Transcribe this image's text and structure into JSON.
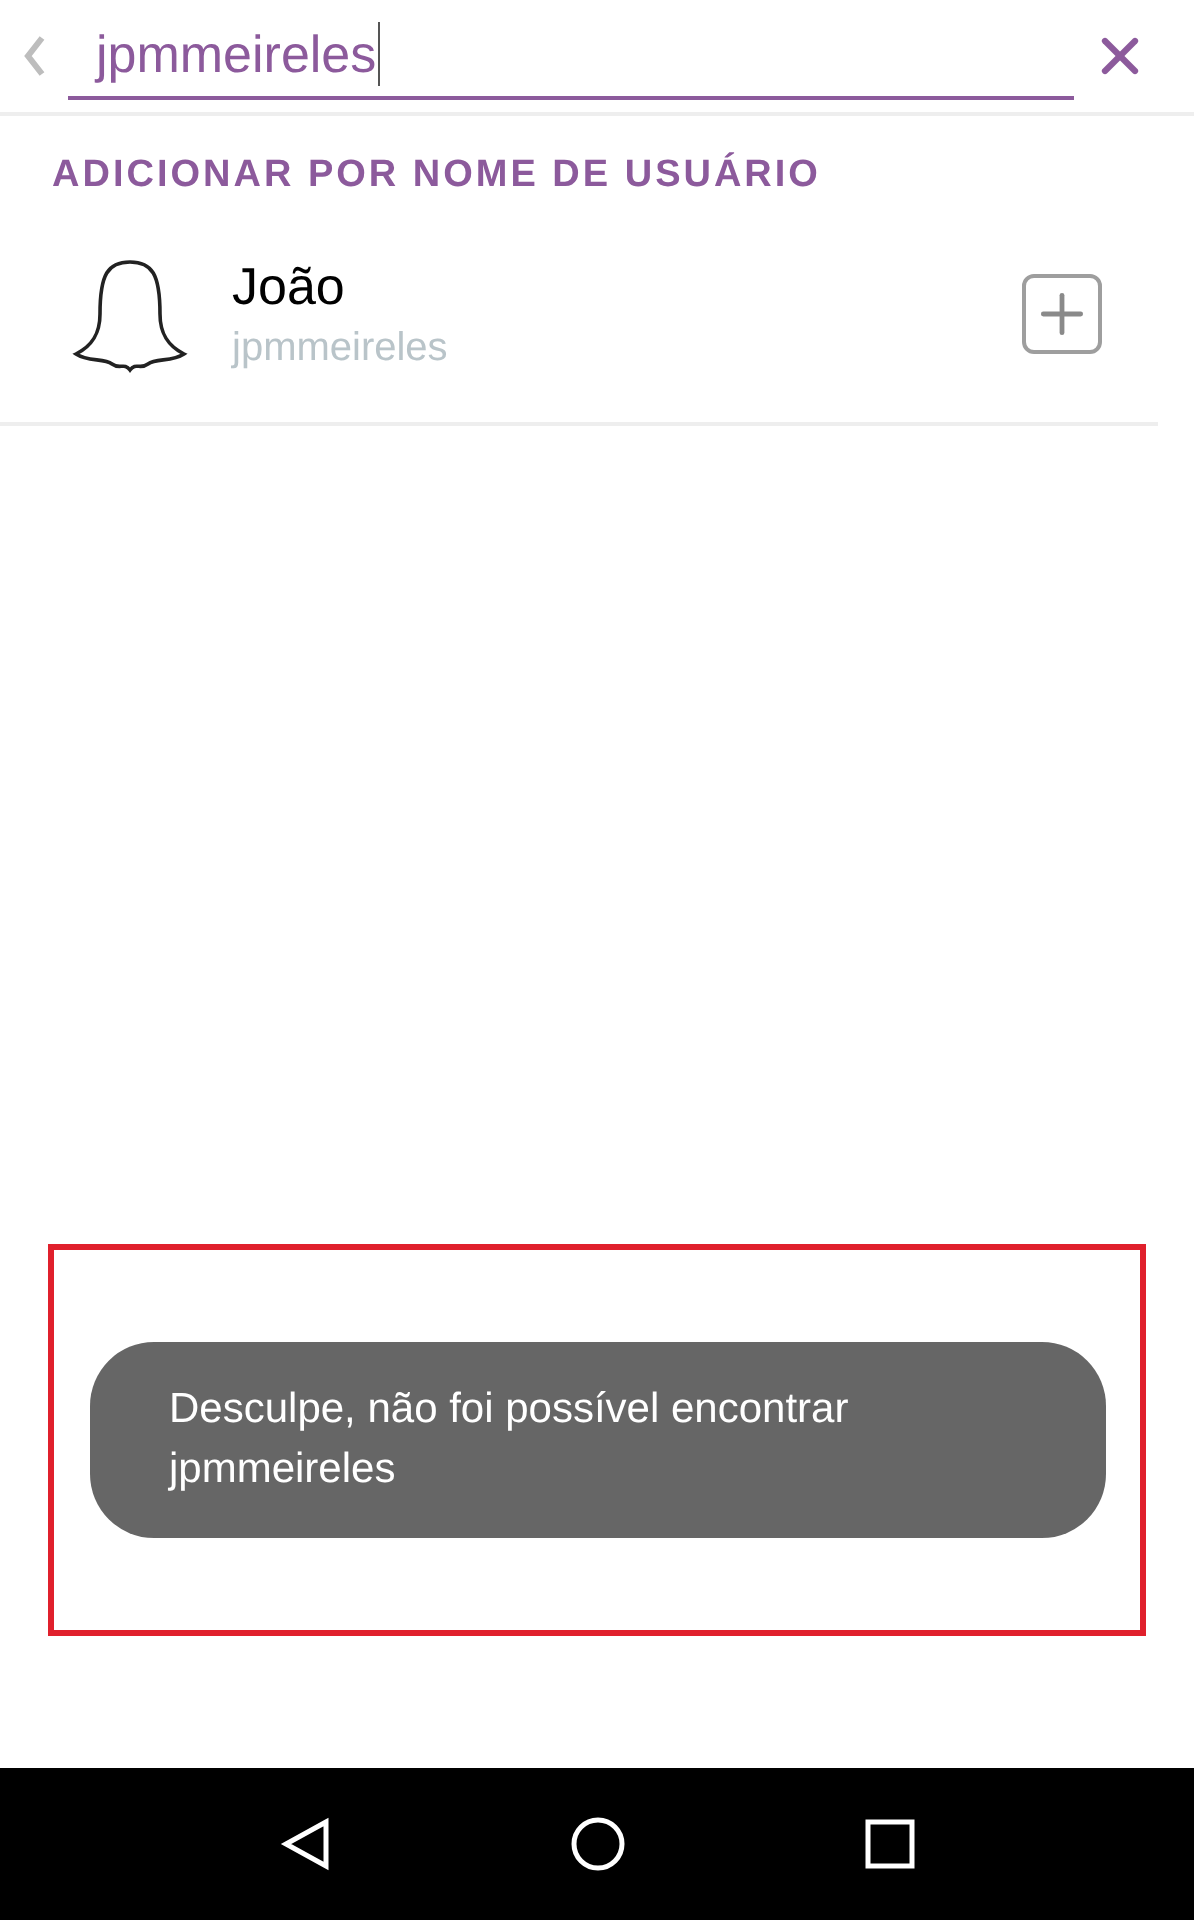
{
  "search": {
    "value": "jpmmeireles"
  },
  "section_title": "ADICIONAR POR NOME DE USUÁRIO",
  "results": [
    {
      "name": "João",
      "username": "jpmmeireles"
    }
  ],
  "toast": {
    "message": "Desculpe, não foi possível encontrar jpmmeireles"
  }
}
